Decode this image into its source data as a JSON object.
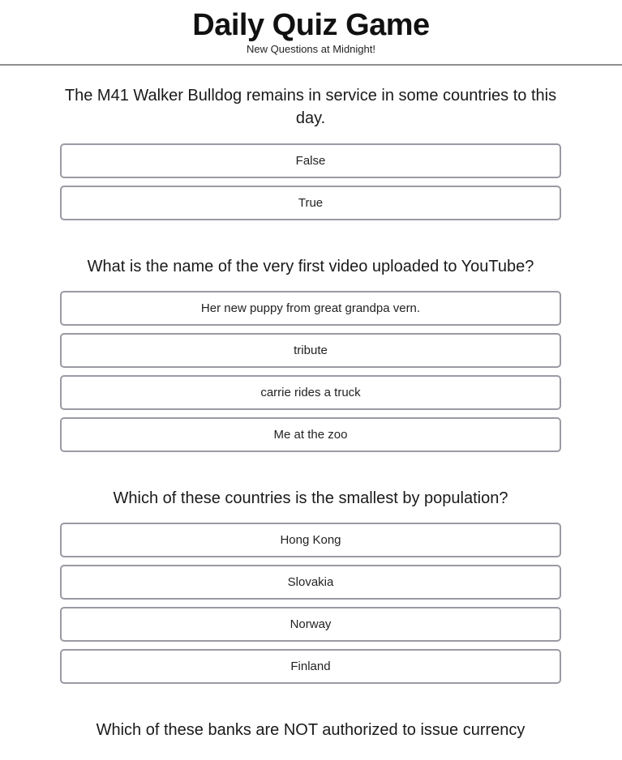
{
  "header": {
    "title": "Daily Quiz Game",
    "subtitle": "New Questions at Midnight!"
  },
  "questions": [
    {
      "text": "The M41 Walker Bulldog remains in service in some countries to this day.",
      "answers": [
        "False",
        "True"
      ]
    },
    {
      "text": "What is the name of the very first video uploaded to YouTube?",
      "answers": [
        "Her new puppy from great grandpa vern.",
        "tribute",
        "carrie rides a truck",
        "Me at the zoo"
      ]
    },
    {
      "text": "Which of these countries is the smallest by population?",
      "answers": [
        "Hong Kong",
        "Slovakia",
        "Norway",
        "Finland"
      ]
    },
    {
      "text": "Which of these banks are NOT authorized to issue currency",
      "answers": []
    }
  ]
}
